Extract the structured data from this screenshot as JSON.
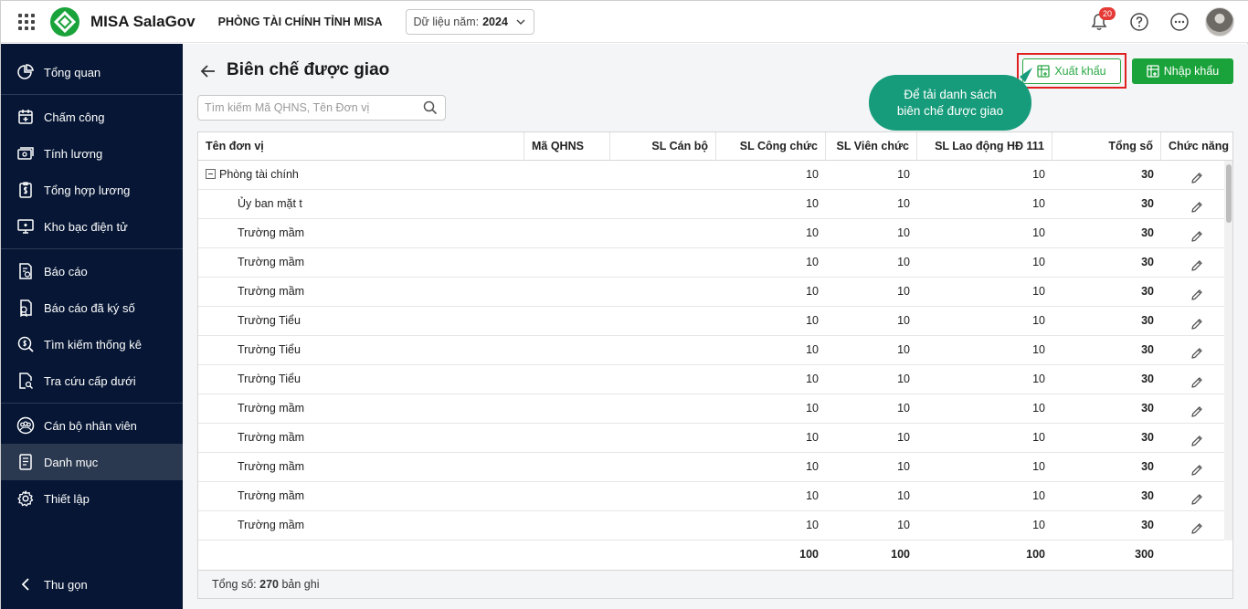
{
  "topbar": {
    "brand": "MISA SalaGov",
    "org": "PHÒNG TÀI CHÍNH TỈNH MISA",
    "year_label": "Dữ liệu năm:",
    "year_value": "2024",
    "notification_count": "20"
  },
  "sidebar": {
    "items": [
      {
        "label": "Tổng quan"
      },
      {
        "label": "Chấm công"
      },
      {
        "label": "Tính lương"
      },
      {
        "label": "Tổng hợp lương"
      },
      {
        "label": "Kho bạc điện tử"
      },
      {
        "label": "Báo cáo"
      },
      {
        "label": "Báo cáo đã ký số"
      },
      {
        "label": "Tìm kiếm thống kê"
      },
      {
        "label": "Tra cứu cấp dưới"
      },
      {
        "label": "Cán bộ nhân viên"
      },
      {
        "label": "Danh mục"
      },
      {
        "label": "Thiết lập"
      }
    ],
    "active": "Danh mục",
    "collapse_label": "Thu gọn"
  },
  "page": {
    "title": "Biên chế được giao",
    "search_placeholder": "Tìm kiếm Mã QHNS, Tên Đơn vị",
    "export_label": "Xuất khẩu",
    "import_label": "Nhập khẩu",
    "tooltip_line1": "Để tải danh sách",
    "tooltip_line2": "biên chế được giao"
  },
  "table": {
    "columns": [
      "Tên đơn vị",
      "Mã QHNS",
      "SL Cán bộ",
      "SL Công chức",
      "SL Viên chức",
      "SL Lao động HĐ 111",
      "Tổng số",
      "Chức năng"
    ],
    "rows": [
      {
        "name": "Phòng tài chính",
        "code": "",
        "canbo": "",
        "congchuc": "10",
        "vienchuc": "10",
        "ld": "10",
        "tong": "30"
      },
      {
        "name": "Ủy ban mặt t",
        "code": "",
        "canbo": "",
        "congchuc": "10",
        "vienchuc": "10",
        "ld": "10",
        "tong": "30"
      },
      {
        "name": "Trường mầm",
        "code": "",
        "canbo": "",
        "congchuc": "10",
        "vienchuc": "10",
        "ld": "10",
        "tong": "30"
      },
      {
        "name": "Trường mầm",
        "code": "",
        "canbo": "",
        "congchuc": "10",
        "vienchuc": "10",
        "ld": "10",
        "tong": "30"
      },
      {
        "name": "Trường mầm",
        "code": "",
        "canbo": "",
        "congchuc": "10",
        "vienchuc": "10",
        "ld": "10",
        "tong": "30"
      },
      {
        "name": "Trường Tiểu",
        "code": "",
        "canbo": "",
        "congchuc": "10",
        "vienchuc": "10",
        "ld": "10",
        "tong": "30"
      },
      {
        "name": "Trường Tiểu",
        "code": "",
        "canbo": "",
        "congchuc": "10",
        "vienchuc": "10",
        "ld": "10",
        "tong": "30"
      },
      {
        "name": "Trường Tiểu",
        "code": "",
        "canbo": "",
        "congchuc": "10",
        "vienchuc": "10",
        "ld": "10",
        "tong": "30"
      },
      {
        "name": "Trường mầm",
        "code": "",
        "canbo": "",
        "congchuc": "10",
        "vienchuc": "10",
        "ld": "10",
        "tong": "30"
      },
      {
        "name": "Trường mầm",
        "code": "",
        "canbo": "",
        "congchuc": "10",
        "vienchuc": "10",
        "ld": "10",
        "tong": "30"
      },
      {
        "name": "Trường mầm",
        "code": "",
        "canbo": "",
        "congchuc": "10",
        "vienchuc": "10",
        "ld": "10",
        "tong": "30"
      },
      {
        "name": "Trường mầm",
        "code": "",
        "canbo": "",
        "congchuc": "10",
        "vienchuc": "10",
        "ld": "10",
        "tong": "30"
      },
      {
        "name": "Trường mầm",
        "code": "",
        "canbo": "",
        "congchuc": "10",
        "vienchuc": "10",
        "ld": "10",
        "tong": "30"
      }
    ],
    "totals": {
      "congchuc": "100",
      "vienchuc": "100",
      "ld": "100",
      "tong": "300"
    },
    "summary_prefix": "Tổng số:",
    "summary_count": "270",
    "summary_suffix": "bản ghi"
  },
  "colors": {
    "sidebar_bg": "#061634",
    "accent_green": "#1aa33a",
    "tooltip_bg": "#179c7b",
    "highlight_red": "#e02020"
  }
}
